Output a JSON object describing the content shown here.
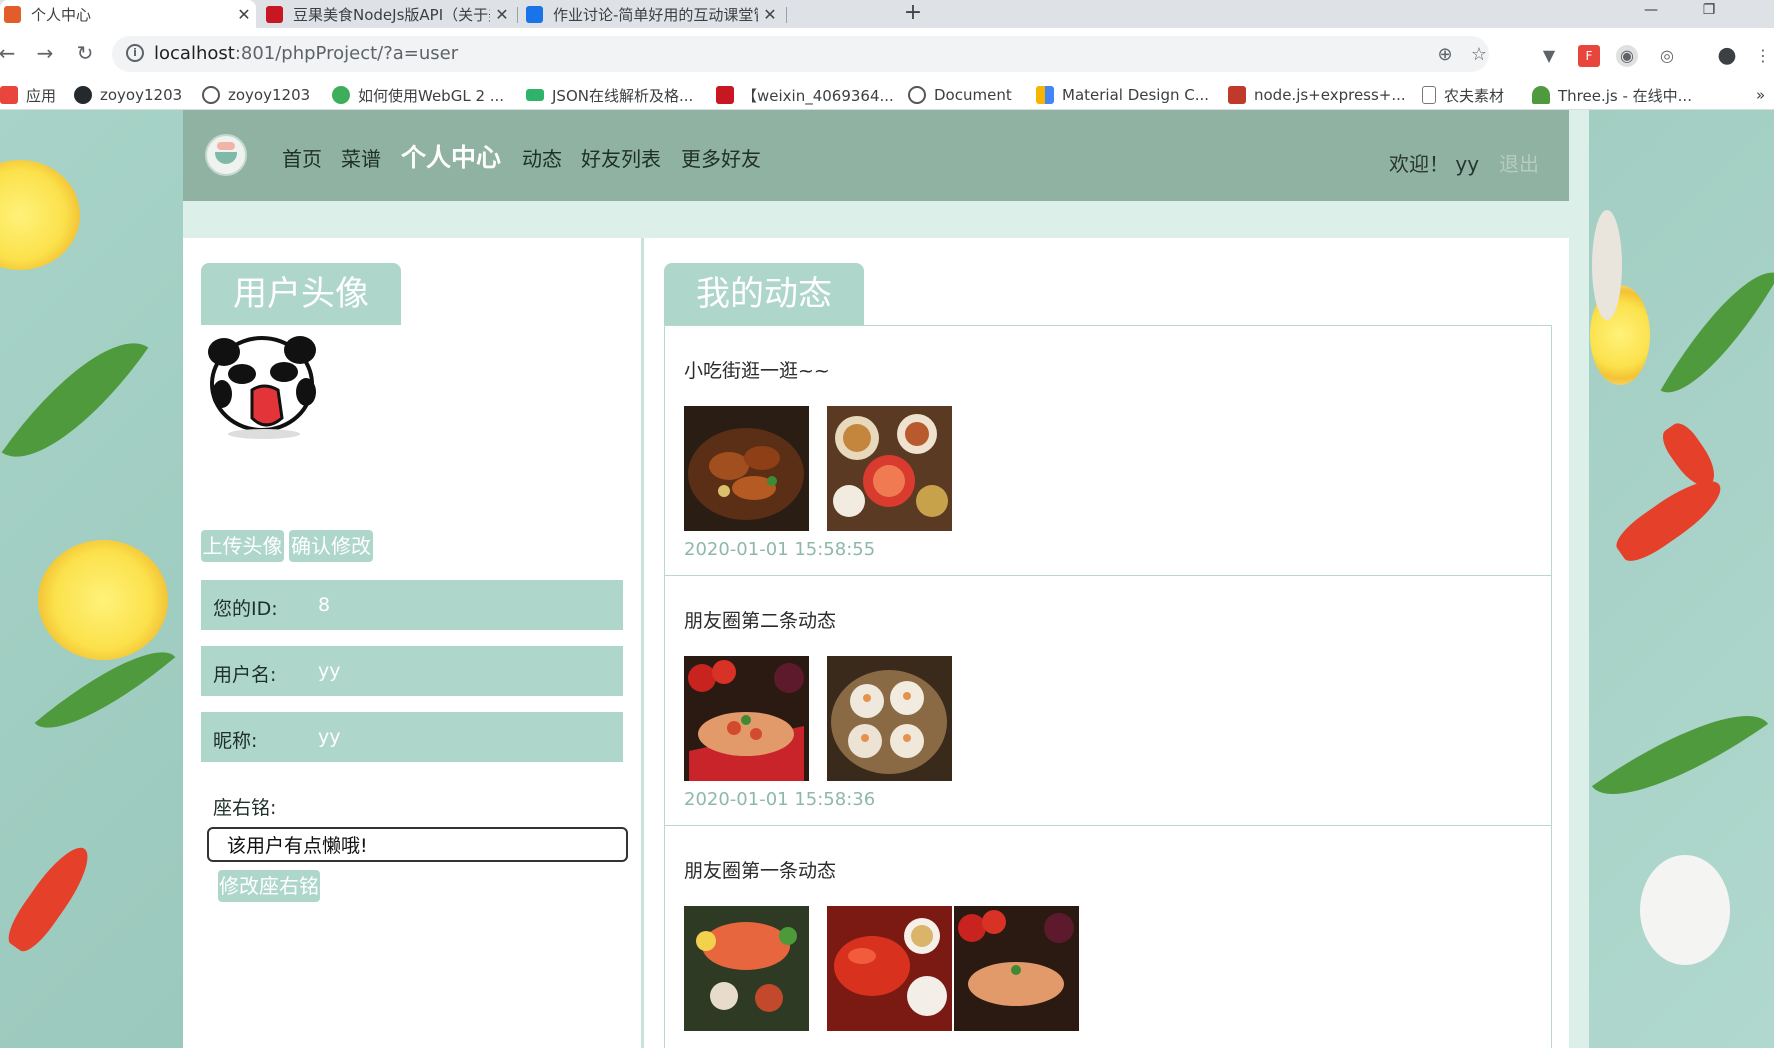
{
  "browser": {
    "tabs": [
      {
        "title": "个人中心",
        "favicon_color": "#e35d2a",
        "active": true
      },
      {
        "title": "豆果美食NodeJs版API（关于美",
        "favicon_color": "#c81623",
        "active": false
      },
      {
        "title": "作业讨论-简单好用的互动课堂管",
        "favicon_color": "#1a73e8",
        "active": false
      }
    ],
    "close_glyph": "✕",
    "new_tab_glyph": "+",
    "window_controls": [
      "—",
      "❐"
    ],
    "nav": {
      "back": "←",
      "forward": "→",
      "reload": "↻"
    },
    "url_host": "localhost",
    "url_rest": ":801/phpProject/?a=user",
    "info_glyph": "i",
    "translate_glyph": "⊕",
    "star_glyph": "☆",
    "menu_glyph": "⋮",
    "extensions": [
      "▼",
      "F",
      "◉",
      "◎",
      "●"
    ],
    "bookmarks": [
      {
        "label": "应用",
        "icon": "apps-icon",
        "color": "#e8453c"
      },
      {
        "label": "zoyoy1203",
        "icon": "github-icon",
        "color": "#24292e"
      },
      {
        "label": "zoyoy1203",
        "icon": "panda-icon",
        "color": "#555555"
      },
      {
        "label": "如何使用WebGL 2 ...",
        "icon": "globe-icon",
        "color": "#3fae5a"
      },
      {
        "label": "JSON在线解析及格...",
        "icon": "json-icon",
        "color": "#2fb36a"
      },
      {
        "label": "【weixin_4069364...",
        "icon": "csdn-icon",
        "color": "#c81623"
      },
      {
        "label": "Document",
        "icon": "panda-icon",
        "color": "#555555"
      },
      {
        "label": "Material Design C...",
        "icon": "material-icon",
        "color": "#f4b400"
      },
      {
        "label": "node.js+express+...",
        "icon": "b-icon",
        "color": "#c0392b"
      },
      {
        "label": "农夫素材",
        "icon": "page-icon",
        "color": "#9aa0a6"
      },
      {
        "label": "Three.js - 在线中...",
        "icon": "tree-icon",
        "color": "#4e9a3c"
      }
    ],
    "more_glyph": "»"
  },
  "site": {
    "nav": [
      {
        "label": "首页",
        "active": false
      },
      {
        "label": "菜谱",
        "active": false
      },
      {
        "label": "个人中心",
        "active": true
      },
      {
        "label": "动态",
        "active": false
      },
      {
        "label": "好友列表",
        "active": false
      },
      {
        "label": "更多好友",
        "active": false
      }
    ],
    "welcome": "欢迎！ yy",
    "logout": "退出"
  },
  "profile": {
    "avatar_title": "用户头像",
    "upload_button": "上传头像",
    "confirm_button": "确认修改",
    "fields": [
      {
        "label": "您的ID:",
        "value": "8"
      },
      {
        "label": "用户名:",
        "value": "yy"
      },
      {
        "label": "昵称:",
        "value": "yy"
      }
    ],
    "motto_label": "座右铭:",
    "motto_value": "该用户有点懒哦!",
    "motto_button": "修改座右铭"
  },
  "feed": {
    "title": "我的动态",
    "posts": [
      {
        "text": "小吃街逛一逛~~",
        "time": "2020-01-01 15:58:55",
        "images": [
          "braised-chicken",
          "hotpot-table"
        ]
      },
      {
        "text": "朋友圈第二条动态",
        "time": "2020-01-01 15:58:36",
        "images": [
          "tomato-pizza",
          "shumai"
        ]
      },
      {
        "text": "朋友圈第一条动态",
        "time": "",
        "images": [
          "salmon-platter",
          "crayfish",
          "tomato-pizza"
        ]
      }
    ]
  }
}
